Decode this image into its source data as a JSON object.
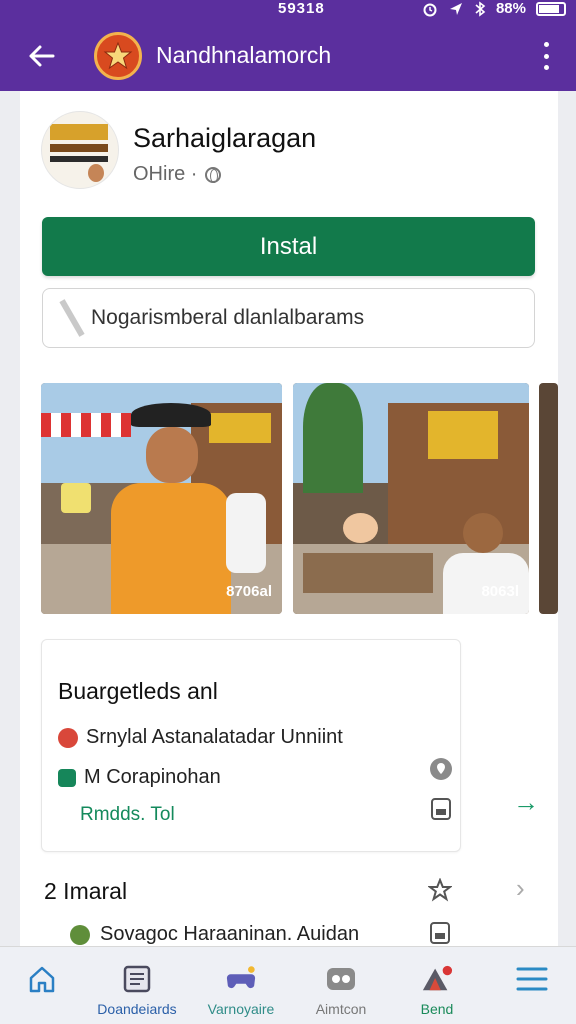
{
  "status_bar": {
    "time": "59318",
    "battery": "88%"
  },
  "app_bar": {
    "title": "Nandhnalamorch"
  },
  "profile": {
    "name": "Sarhaiglaragan",
    "status": "OHire ·"
  },
  "install_label": "Instal",
  "search": {
    "value": "Nogarismberal dlanlalbarams"
  },
  "gallery": {
    "tags": [
      "8706al",
      "8063l"
    ]
  },
  "section1": {
    "title": "Buargetleds anl",
    "rows": [
      "Srnylal Astanalatadar Unniint",
      "M Corapinohan"
    ],
    "link": "Rmdds. Tol"
  },
  "section2": {
    "title": "2 Imaral",
    "row": "Sovagoc Haraaninan. Auidan"
  },
  "bottom_nav": [
    {
      "label": "Doandeiards",
      "icon": "home-icon"
    },
    {
      "label": "Varnoyaire",
      "icon": "gamepad-icon"
    },
    {
      "label": "Aimtcon",
      "icon": "controller-icon"
    },
    {
      "label": "Bend",
      "icon": "alert-icon"
    },
    {
      "label": "",
      "icon": "menu-icon"
    }
  ],
  "colors": {
    "primary": "#5b2f9e",
    "install": "#127a4b",
    "accent_green": "#148a5c"
  }
}
